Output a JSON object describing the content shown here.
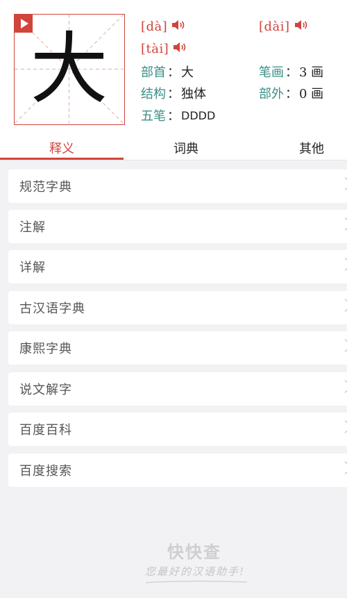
{
  "character": {
    "glyph": "大",
    "pronunciations": [
      {
        "text": "[dà]",
        "icon": "speaker-icon"
      },
      {
        "text": "[dài]",
        "icon": "speaker-icon"
      },
      {
        "text": "[tài]",
        "icon": "speaker-icon"
      }
    ],
    "info": {
      "radical_label": "部首",
      "radical_value": "大",
      "strokes_label": "笔画",
      "strokes_value": "3 画",
      "structure_label": "结构",
      "structure_value": "独体",
      "extra_strokes_label": "部外",
      "extra_strokes_value": "0 画",
      "wubi_label": "五笔",
      "wubi_value": "DDDD",
      "colon": "："
    }
  },
  "tabs": [
    {
      "label": "释义",
      "active": true
    },
    {
      "label": "词典",
      "active": false
    },
    {
      "label": "其他",
      "active": false
    }
  ],
  "list": [
    {
      "label": "规范字典"
    },
    {
      "label": "注解"
    },
    {
      "label": "详解"
    },
    {
      "label": "古汉语字典"
    },
    {
      "label": "康熙字典"
    },
    {
      "label": "说文解字"
    },
    {
      "label": "百度百科"
    },
    {
      "label": "百度搜索"
    }
  ],
  "footer": {
    "brand": "快快查",
    "slogan": "您最好的汉语助手!"
  },
  "colors": {
    "accent": "#d0443a",
    "label_teal": "#3a8f86",
    "background": "#f2f2f4"
  }
}
